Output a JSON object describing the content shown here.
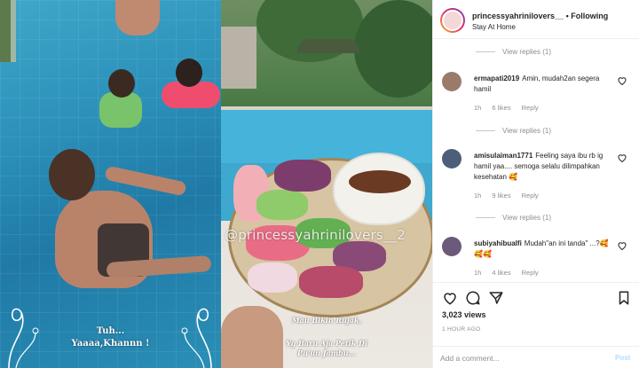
{
  "story_left": {
    "caption_line1": "Tuh...",
    "caption_line2": "Yaaaa,Khannn !"
  },
  "story_right": {
    "watermark": "@princessyahrinilovers__2",
    "caption_line1": "Mau Bikin Rujak,",
    "caption_line2": "Yg Baru Aja Petik Di",
    "caption_line3": "Pu'un Jambu..."
  },
  "header": {
    "username": "princessyahrinilovers__",
    "separator": "•",
    "follow_label": "Following",
    "location": "Stay At Home"
  },
  "comments": {
    "view_replies_top": "View replies (1)",
    "items": [
      {
        "username": "ermapati2019",
        "text": "Amin, mudah2an segera hamil",
        "time": "1h",
        "likes": "6 likes",
        "reply": "Reply",
        "view_replies": "View replies (1)",
        "avatar_color": "#9a7b6a"
      },
      {
        "username": "amisulaiman1771",
        "text": "Feeling saya ibu rb ig hamil yaa.... semoga selalu dilimpahkan kesehatan 🥰",
        "time": "1h",
        "likes": "9 likes",
        "reply": "Reply",
        "view_replies": "View replies (1)",
        "avatar_color": "#4d5e7a"
      },
      {
        "username": "subiyahibualfi",
        "text": "Mudah\"an ini tanda\" ...?🥰🥰🥰",
        "time": "1h",
        "likes": "4 likes",
        "reply": "Reply",
        "avatar_color": "#6b5a7a"
      }
    ]
  },
  "footer": {
    "views": "3,023 views",
    "time_ago": "1 HOUR AGO",
    "comment_placeholder": "Add a comment...",
    "post_label": "Post"
  },
  "icons": {
    "heart": "heart-icon",
    "comment": "comment-icon",
    "share": "share-icon",
    "save": "bookmark-icon"
  },
  "colors": {
    "link_muted": "#8e8e8e",
    "post_disabled": "#b3dbff",
    "text": "#262626"
  }
}
